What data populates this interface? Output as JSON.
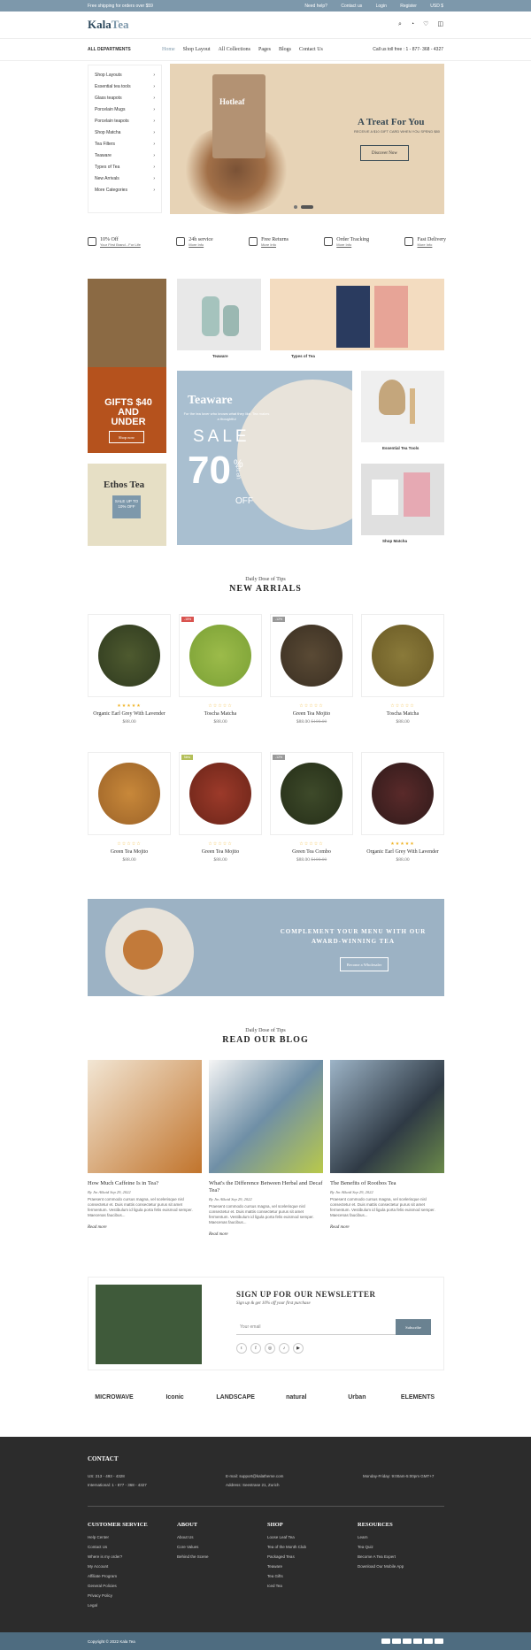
{
  "topbar": {
    "promo": "Free shipping for orders over $59",
    "links": [
      "Need help?",
      "Contact us",
      "Login",
      "Register",
      "USD $"
    ]
  },
  "header": {
    "logo": "Kala",
    "logo2": "Tea",
    "icons": [
      "search-icon",
      "user-icon",
      "heart-icon",
      "cart-icon"
    ]
  },
  "nav": {
    "all": "ALL DEPARTMENTS",
    "items": [
      "Home",
      "Shop Layout",
      "All Collections",
      "Pages",
      "Blogs",
      "Contact Us"
    ],
    "call": "Call us toll free : 1 - 877- 368 - 4327"
  },
  "sidebar": [
    "Shop Layouts",
    "Essential tea tools",
    "Glass teapots",
    "Porcelain Mugs",
    "Porcelain teapots",
    "Shop Matcha",
    "Tea Filters",
    "Teaware",
    "Types of Tea",
    "New Arrivals",
    "More Categories"
  ],
  "hero": {
    "pack": "Hotleaf",
    "title": "A Treat For You",
    "sub": "RECEIVE A $10 GIFT CARD WHEN YOU SPEND $80",
    "button": "Discover Now"
  },
  "features": [
    {
      "t": "10% Off",
      "s": "Your First Brand - For Life"
    },
    {
      "t": "24h service",
      "s": "More Info"
    },
    {
      "t": "Free Returns",
      "s": "More Info"
    },
    {
      "t": "Order Tracking",
      "s": "More Info"
    },
    {
      "t": "Fast Delivery",
      "s": "More Info"
    }
  ],
  "tiles": {
    "gifts": "GIFTS $40 AND UNDER",
    "shop": "Shop now",
    "teaware": "Teaware",
    "types": "Types of Tea",
    "tw_title": "Teaware",
    "tw_sub": "For the tea lover who knows what they like. Tea makes a thoughtful",
    "sale": "SALE",
    "pct": "70",
    "upto": "UP TO",
    "off": "OFF",
    "essential": "Essential Tea Tools",
    "ethos": "Ethos Tea",
    "ethos_sale": "SALE UP TO 10% OFF",
    "matcha": "Shop Matcha"
  },
  "new": {
    "small": "Daily Dose of Tips",
    "big": "NEW ARRIALS"
  },
  "products": [
    {
      "name": "Organic Earl Grey With Lavender",
      "price": "$88.00",
      "old": "",
      "badge": "",
      "stars": "★★★★★"
    },
    {
      "name": "Toscha Matcha",
      "price": "$88.00",
      "old": "",
      "badge": "-15%",
      "stars": "☆☆☆☆☆"
    },
    {
      "name": "Green Tea Mojito",
      "price": "$88.00",
      "old": "$100.00",
      "badge": "-12%",
      "stars": "☆☆☆☆☆"
    },
    {
      "name": "Toscha Matcha",
      "price": "$88.00",
      "old": "",
      "badge": "",
      "stars": "☆☆☆☆☆"
    },
    {
      "name": "Green Tea Mojito",
      "price": "$88.00",
      "old": "",
      "badge": "",
      "stars": "☆☆☆☆☆"
    },
    {
      "name": "Green Tea Mojito",
      "price": "$88.00",
      "old": "",
      "badge": "New",
      "stars": "☆☆☆☆☆"
    },
    {
      "name": "Green Tea Combo",
      "price": "$88.00",
      "old": "$100.00",
      "badge": "-12%",
      "stars": "☆☆☆☆☆"
    },
    {
      "name": "Organic Earl Grey With Lavender",
      "price": "$88.00",
      "old": "",
      "badge": "",
      "stars": "★★★★★"
    }
  ],
  "banner2": {
    "t": "COMPLEMENT YOUR MENU WITH OUR AWARD-WINNING TEA",
    "b": "Become a Wholesaler"
  },
  "blog": {
    "small": "Daily Dose of Tips",
    "big": "READ OUR BLOG",
    "posts": [
      {
        "t": "How Much Caffeine Is in Tea?",
        "m": "By Jin Alkaid  Sep 29, 2022",
        "e": "Praesent commodo cursus magna, vel scelerisque nisl consectetur et. Duis mattis consectetur purus sit amet fermentum. Vestibulum id ligula porta felis euismod semper. Maecenas faucibus...",
        "r": "Read more"
      },
      {
        "t": "What's the Difference Between Herbal and Decaf Tea?",
        "m": "By Jin Alkaid  Sep 29, 2022",
        "e": "Praesent commodo cursus magna, vel scelerisque nisl consectetur et. Duis mattis consectetur purus sit amet fermentum. Vestibulum id ligula porta felis euismod semper. Maecenas faucibus...",
        "r": "Read more"
      },
      {
        "t": "The Benefits of Rooibos Tea",
        "m": "By Jin Alkaid  Sep 29, 2022",
        "e": "Praesent commodo cursus magna, vel scelerisque nisl consectetur et. Duis mattis consectetur purus sit amet fermentum. Vestibulum id ligula porta felis euismod semper. Maecenas faucibus...",
        "r": "Read more"
      }
    ]
  },
  "newsletter": {
    "t": "SIGN UP FOR OUR NEWSLETTER",
    "s": "Sign up & get 10% off your first purchase",
    "ph": "Your email",
    "b": "Subscribe"
  },
  "brands": [
    "MICROWAVE",
    "Iconic",
    "LANDSCAPE",
    "natural",
    "Urban",
    "ELEMENTS"
  ],
  "footer": {
    "contact": "CONTACT",
    "us": "US: 213 - 493 - 4328",
    "intl": "International: 1 - 877 - 368 - 4327",
    "email": "E-mail: support@kalatheme.com",
    "addr": "Address: Seestrase 21, Zurich",
    "hours": "Monday-Friday: 9:00am-5:00pm GMT+7",
    "cols": [
      {
        "h": "CUSTOMER SERVICE",
        "items": [
          "Help Center",
          "Contact Us",
          "Where is my order?",
          "My Account",
          "Affiliate Program",
          "General Policies",
          "Privacy Policy",
          "Legal"
        ]
      },
      {
        "h": "ABOUT",
        "items": [
          "About Us",
          "Core Values",
          "Behind the Scene"
        ]
      },
      {
        "h": "SHOP",
        "items": [
          "Loose Leaf Tea",
          "Tea of the Month Club",
          "Packaged Teas",
          "Teaware",
          "Tea Gifts",
          "Iced Tea"
        ]
      },
      {
        "h": "RESOURCES",
        "items": [
          "Learn",
          "Tea Quiz",
          "Become A Tea Expert",
          "Download Our Mobile App"
        ]
      }
    ],
    "copy": "Copyright © 2022 Kala Tea"
  }
}
